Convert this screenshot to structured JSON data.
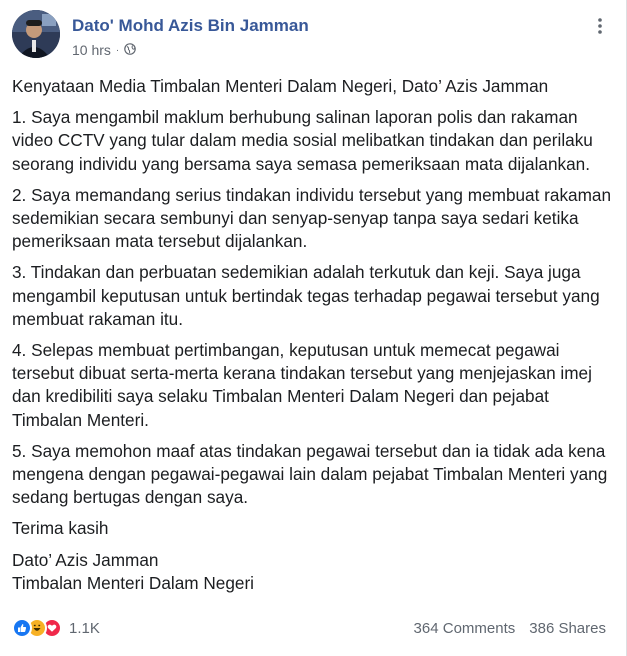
{
  "post": {
    "author": "Dato' Mohd Azis Bin Jamman",
    "timestamp": "10 hrs",
    "separator": "·",
    "privacy_icon": "globe-icon",
    "more_icon": "more-options-icon",
    "paragraphs": [
      "Kenyataan Media Timbalan Menteri Dalam Negeri, Dato’ Azis Jamman",
      "1. Saya mengambil maklum berhubung salinan laporan polis dan rakaman video CCTV yang tular dalam media sosial melibatkan tindakan dan perilaku seorang individu yang bersama saya semasa pemeriksaan mata dijalankan.",
      "2. Saya memandang serius tindakan individu tersebut yang membuat rakaman sedemikian secara sembunyi dan senyap-senyap tanpa saya sedari ketika pemeriksaan mata tersebut dijalankan.",
      "3. Tindakan dan perbuatan sedemikian adalah terkutuk dan keji. Saya juga mengambil keputusan untuk bertindak tegas terhadap pegawai tersebut yang membuat rakaman itu.",
      "4. Selepas membuat pertimbangan, keputusan untuk memecat pegawai tersebut dibuat serta-merta kerana tindakan tersebut yang menjejaskan imej dan kredibiliti saya selaku Timbalan Menteri Dalam Negeri dan pejabat Timbalan Menteri.",
      "5. Saya memohon maaf atas tindakan pegawai tersebut dan ia tidak ada kena mengena dengan pegawai-pegawai lain dalam pejabat Timbalan Menteri yang sedang bertugas dengan saya.",
      "Terima kasih"
    ],
    "signature_name": "Dato’ Azis Jamman",
    "signature_title": "Timbalan Menteri Dalam Negeri"
  },
  "footer": {
    "reactions": [
      "like-icon",
      "haha-icon",
      "love-icon"
    ],
    "reaction_count": "1.1K",
    "comments": "364 Comments",
    "shares": "386 Shares"
  },
  "colors": {
    "author_link": "#385898",
    "meta_text": "#616770",
    "like": "#1877f2",
    "haha": "#f7b125",
    "love": "#f0284a"
  }
}
